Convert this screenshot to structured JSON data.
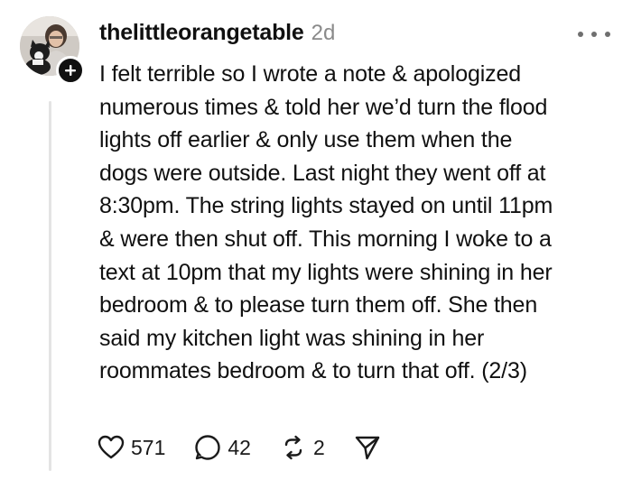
{
  "post": {
    "username": "thelittleorangetable",
    "timestamp": "2d",
    "body_lines": [
      "I felt terrible so I wrote a note & apologized",
      "numerous times & told her we’d turn the flood",
      "lights off earlier & only use them when the",
      "dogs were outside. Last night they went off at",
      "8:30pm. The string lights stayed on until 11pm",
      "& were then shut off. This morning I woke to a",
      "text at 10pm that my lights were shining in her",
      "bedroom & to please turn them off. She then",
      "said my kitchen light was shining in her",
      "roommates bedroom & to turn that off. (2/3)"
    ]
  },
  "actions": {
    "like_count": "571",
    "reply_count": "42",
    "repost_count": "2"
  },
  "icons": {
    "follow": "plus-icon",
    "more": "more-icon",
    "like": "heart-icon",
    "reply": "comment-icon",
    "repost": "repost-icon",
    "share": "send-icon"
  }
}
